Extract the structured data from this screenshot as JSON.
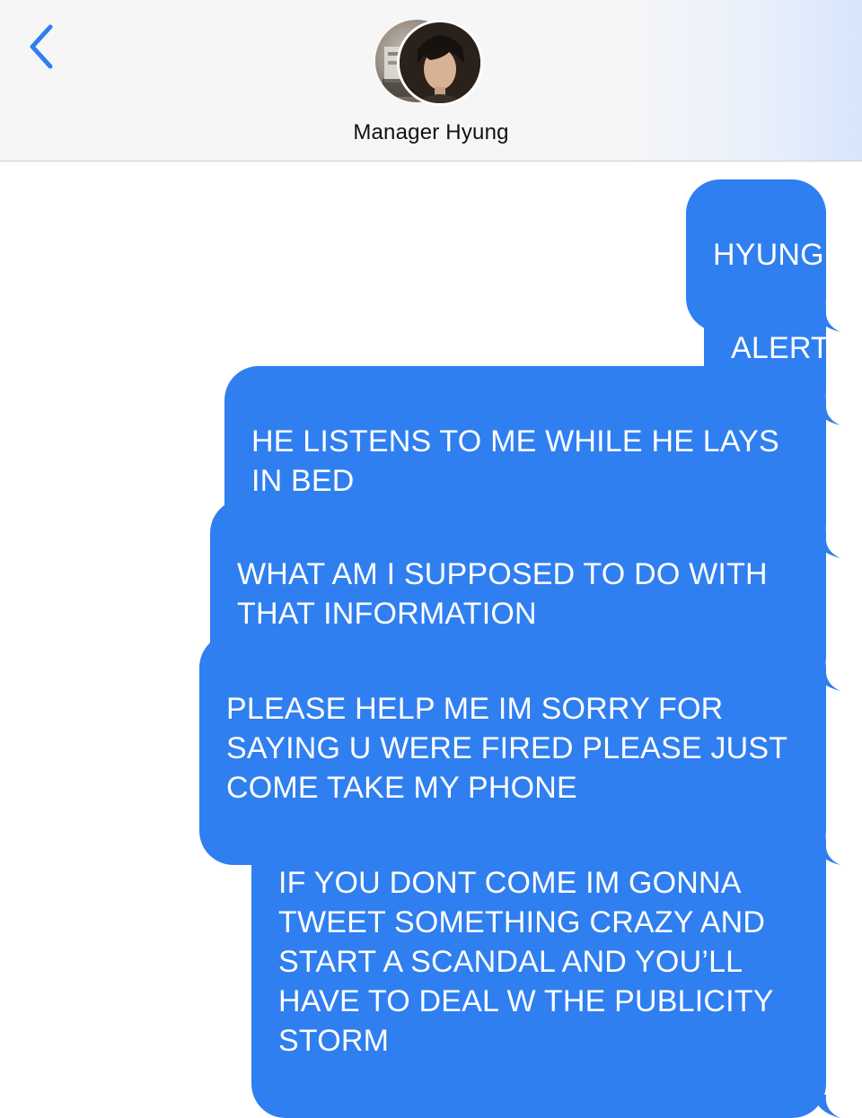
{
  "header": {
    "contact_name": "Manager Hyung",
    "back_icon": "chevron-left-icon",
    "accent_color": "#2f7ff0"
  },
  "messages": [
    {
      "direction": "outgoing",
      "text": "HYUNG"
    },
    {
      "direction": "outgoing",
      "text": "ALERT"
    },
    {
      "direction": "outgoing",
      "text": "HE LISTENS TO ME WHILE HE LAYS IN BED"
    },
    {
      "direction": "outgoing",
      "text": "WHAT AM I SUPPOSED TO DO WITH THAT INFORMATION"
    },
    {
      "direction": "outgoing",
      "text": "PLEASE HELP ME IM SORRY FOR SAYING U WERE FIRED PLEASE JUST COME TAKE MY PHONE"
    },
    {
      "direction": "outgoing",
      "text": "IF YOU DONT COME IM GONNA TWEET SOMETHING CRAZY AND START A SCANDAL AND YOU’LL HAVE TO DEAL W THE PUBLICITY STORM"
    }
  ],
  "colors": {
    "bubble": "#2f7ff0",
    "bubble_text": "#ffffff",
    "header_bg": "#f6f6f7"
  }
}
